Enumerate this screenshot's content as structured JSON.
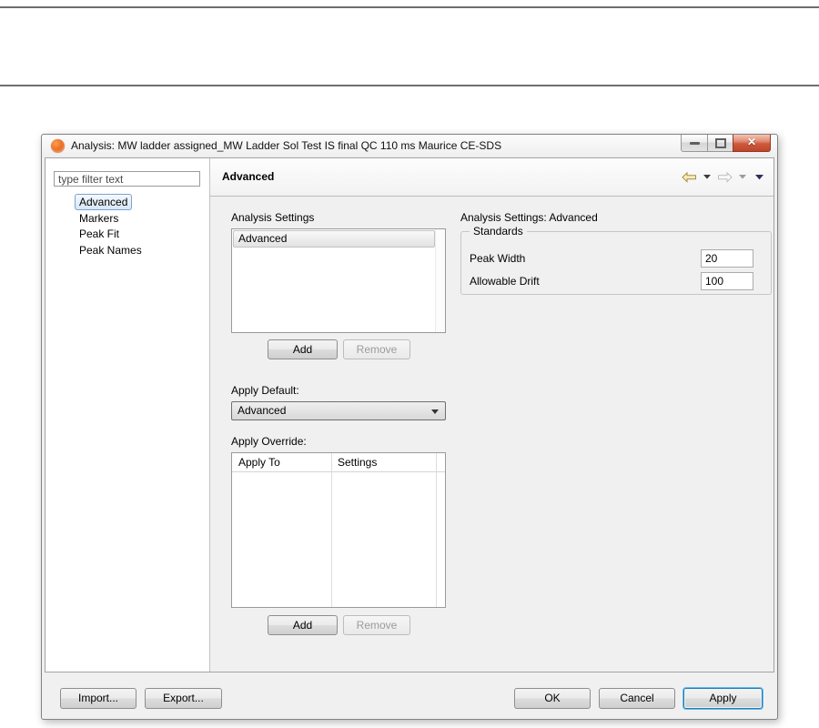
{
  "window": {
    "title": "Analysis: MW ladder assigned_MW Ladder Sol Test IS final QC 110 ms Maurice CE-SDS"
  },
  "sidebar": {
    "filter_placeholder": "type filter text",
    "items": [
      {
        "label": "Advanced",
        "selected": true
      },
      {
        "label": "Markers",
        "selected": false
      },
      {
        "label": "Peak Fit",
        "selected": false
      },
      {
        "label": "Peak Names",
        "selected": false
      }
    ]
  },
  "page": {
    "header_title": "Advanced"
  },
  "analysis_settings": {
    "label": "Analysis Settings",
    "items": [
      "Advanced"
    ],
    "add_label": "Add",
    "remove_label": "Remove"
  },
  "apply_default": {
    "label": "Apply Default:",
    "value": "Advanced"
  },
  "apply_override": {
    "label": "Apply Override:",
    "columns": [
      "Apply To",
      "Settings"
    ],
    "rows": [],
    "add_label": "Add",
    "remove_label": "Remove"
  },
  "details": {
    "title": "Analysis Settings: Advanced",
    "group_label": "Standards",
    "fields": [
      {
        "label": "Peak Width",
        "value": "20"
      },
      {
        "label": "Allowable Drift",
        "value": "100"
      }
    ]
  },
  "footer": {
    "import_label": "Import...",
    "export_label": "Export...",
    "ok_label": "OK",
    "cancel_label": "Cancel",
    "apply_label": "Apply"
  },
  "icons": {
    "app": "orange-circle-logo",
    "minimize": "–",
    "maximize": "□",
    "close": "✕",
    "back": "gold-left-arrow",
    "forward": "gray-right-arrow",
    "dropdown": "▼"
  },
  "colors": {
    "close_button_red": "#c0442a",
    "app_icon_orange": "#e8641b",
    "tree_selection_blue": "#7da2ce",
    "apply_focus_blue": "#63bde6",
    "panel_gray": "#f0f0f0",
    "rule_gray": "#6e6e6e"
  }
}
